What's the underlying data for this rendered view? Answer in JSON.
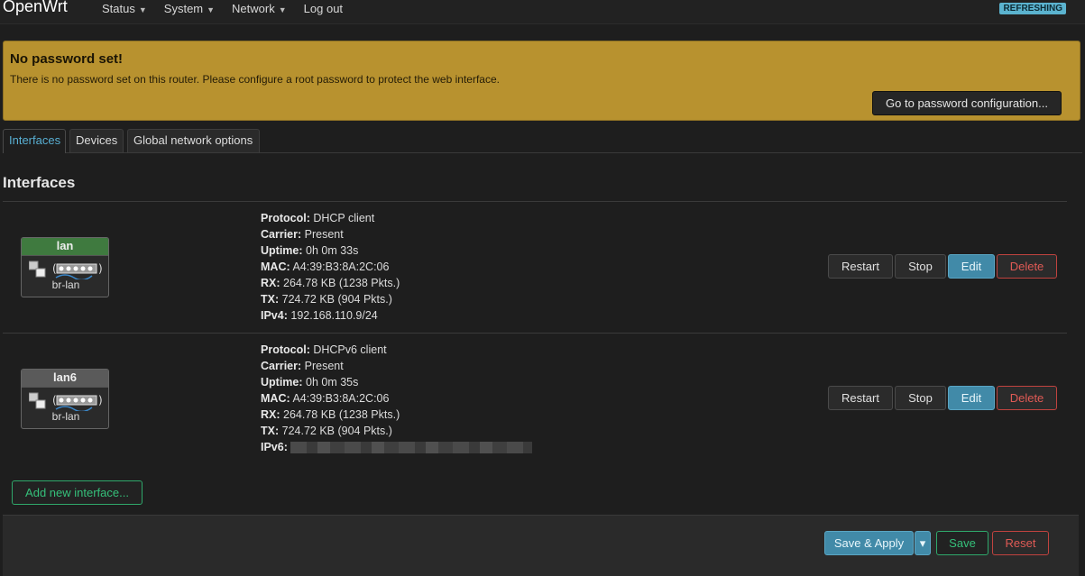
{
  "header": {
    "brand": "OpenWrt",
    "nav": [
      "Status",
      "System",
      "Network",
      "Log out"
    ],
    "badge": "REFRESHING"
  },
  "alert": {
    "title": "No password set!",
    "text": "There is no password set on this router. Please configure a root password to protect the web interface.",
    "button": "Go to password configuration..."
  },
  "tabs": [
    "Interfaces",
    "Devices",
    "Global network options"
  ],
  "section_title": "Interfaces",
  "interfaces": [
    {
      "name": "lan",
      "device": "br-lan",
      "rows": [
        {
          "k": "Protocol:",
          "v": "DHCP client"
        },
        {
          "k": "Carrier:",
          "v": "Present"
        },
        {
          "k": "Uptime:",
          "v": "0h 0m 33s"
        },
        {
          "k": "MAC:",
          "v": "A4:39:B3:8A:2C:06"
        },
        {
          "k": "RX:",
          "v": "264.78 KB (1238 Pkts.)"
        },
        {
          "k": "TX:",
          "v": "724.72 KB (904 Pkts.)"
        },
        {
          "k": "IPv4:",
          "v": "192.168.110.9/24"
        }
      ]
    },
    {
      "name": "lan6",
      "device": "br-lan",
      "rows": [
        {
          "k": "Protocol:",
          "v": "DHCPv6 client"
        },
        {
          "k": "Carrier:",
          "v": "Present"
        },
        {
          "k": "Uptime:",
          "v": "0h 0m 35s"
        },
        {
          "k": "MAC:",
          "v": "A4:39:B3:8A:2C:06"
        },
        {
          "k": "RX:",
          "v": "264.78 KB (1238 Pkts.)"
        },
        {
          "k": "TX:",
          "v": "724.72 KB (904 Pkts.)"
        },
        {
          "k": "IPv6:",
          "v": ""
        }
      ]
    }
  ],
  "row_buttons": {
    "restart": "Restart",
    "stop": "Stop",
    "edit": "Edit",
    "delete": "Delete"
  },
  "add_button": "Add new interface...",
  "footer": {
    "save_apply": "Save & Apply",
    "dropdown": "▾",
    "save": "Save",
    "reset": "Reset"
  }
}
